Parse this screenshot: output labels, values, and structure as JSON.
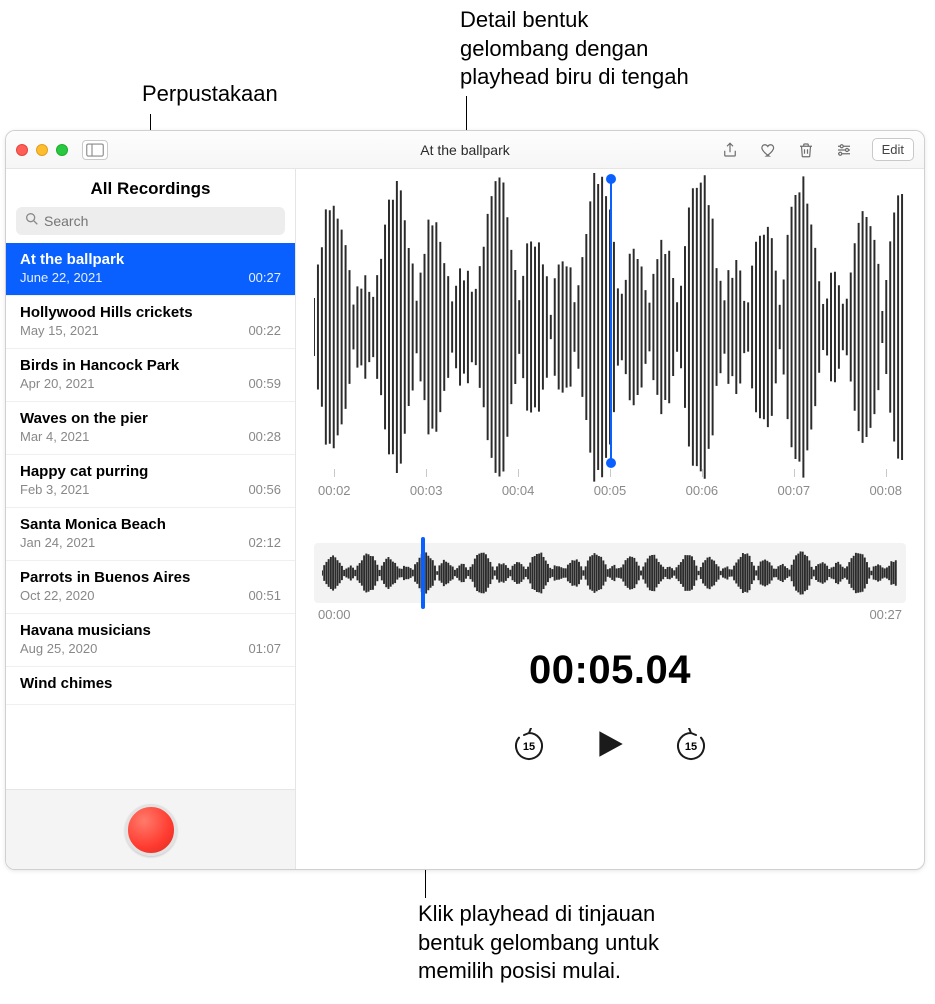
{
  "callouts": {
    "library": "Perpustakaan",
    "waveform_detail": "Detail bentuk\ngelombang dengan\nplayhead biru di tengah",
    "overview_hint": "Klik playhead di tinjauan\nbentuk gelombang untuk\nmemilih posisi mulai."
  },
  "window": {
    "title": "At the ballpark",
    "edit_label": "Edit"
  },
  "sidebar": {
    "header": "All Recordings",
    "search_placeholder": "Search",
    "recordings": [
      {
        "title": "At the ballpark",
        "date": "June 22, 2021",
        "duration": "00:27",
        "selected": true
      },
      {
        "title": "Hollywood Hills crickets",
        "date": "May 15, 2021",
        "duration": "00:22"
      },
      {
        "title": "Birds in Hancock Park",
        "date": "Apr 20, 2021",
        "duration": "00:59"
      },
      {
        "title": "Waves on the pier",
        "date": "Mar 4, 2021",
        "duration": "00:28"
      },
      {
        "title": "Happy cat purring",
        "date": "Feb 3, 2021",
        "duration": "00:56"
      },
      {
        "title": "Santa Monica Beach",
        "date": "Jan 24, 2021",
        "duration": "02:12"
      },
      {
        "title": "Parrots in Buenos Aires",
        "date": "Oct 22, 2020",
        "duration": "00:51"
      },
      {
        "title": "Havana musicians",
        "date": "Aug 25, 2020",
        "duration": "01:07"
      },
      {
        "title": "Wind chimes",
        "date": "",
        "duration": ""
      }
    ]
  },
  "detail": {
    "tick_labels": [
      "00:02",
      "00:03",
      "00:04",
      "00:05",
      "00:06",
      "00:07",
      "00:08"
    ],
    "overview_start": "00:00",
    "overview_end": "00:27",
    "current_time": "00:05.04",
    "skip_amount": "15"
  },
  "icons": {
    "share": "share-icon",
    "favorite": "heart-icon",
    "delete": "trash-icon",
    "options": "sliders-icon"
  }
}
